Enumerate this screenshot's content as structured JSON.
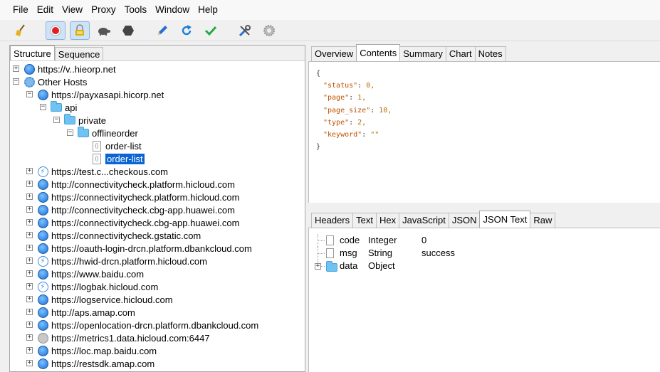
{
  "menu": [
    "File",
    "Edit",
    "View",
    "Proxy",
    "Tools",
    "Window",
    "Help"
  ],
  "toolbar": [
    {
      "name": "broom-icon",
      "color": "#e8b21a"
    },
    {
      "name": "record-icon",
      "color": "#e02020",
      "pressed": true
    },
    {
      "name": "ssl-lock-icon",
      "color": "#e0b000",
      "pressed": true
    },
    {
      "name": "throttle-turtle-icon",
      "color": "#555555"
    },
    {
      "name": "breakpoint-hexagon-icon",
      "color": "#444444"
    },
    {
      "name": "compose-pen-icon",
      "color": "#2a6fd0"
    },
    {
      "name": "repeat-icon",
      "color": "#1a7fd6"
    },
    {
      "name": "validate-check-icon",
      "color": "#22aa44"
    },
    {
      "name": "tools-icon",
      "color": "#2a6fd0"
    },
    {
      "name": "settings-gear-icon",
      "color": "#9a9a9a"
    }
  ],
  "left_tabs": [
    "Structure",
    "Sequence"
  ],
  "tree": [
    {
      "label": "https://v..hieorp.net",
      "depth": 0,
      "expander": "+",
      "icon": "globe-icon"
    },
    {
      "label": "Other Hosts",
      "depth": 0,
      "expander": "−",
      "icon": "gear-icon"
    },
    {
      "label": "https://payxasapi.hicorp.net",
      "depth": 1,
      "expander": "−",
      "icon": "globe-icon"
    },
    {
      "label": "api",
      "depth": 2,
      "expander": "−",
      "icon": "folder-icon"
    },
    {
      "label": "private",
      "depth": 3,
      "expander": "−",
      "icon": "folder-icon"
    },
    {
      "label": "offlineorder",
      "depth": 4,
      "expander": "−",
      "icon": "folder-icon"
    },
    {
      "label": "order-list",
      "depth": 5,
      "expander": "",
      "icon": "request-icon"
    },
    {
      "label": "order-list",
      "depth": 5,
      "expander": "",
      "icon": "request-icon",
      "selected": true
    },
    {
      "label": "https://test.c...checkous.com",
      "depth": 1,
      "expander": "+",
      "icon": "hwid-icon"
    },
    {
      "label": "http://connectivitycheck.platform.hicloud.com",
      "depth": 1,
      "expander": "+",
      "icon": "globe-icon"
    },
    {
      "label": "https://connectivitycheck.platform.hicloud.com",
      "depth": 1,
      "expander": "+",
      "icon": "globe-icon"
    },
    {
      "label": "http://connectivitycheck.cbg-app.huawei.com",
      "depth": 1,
      "expander": "+",
      "icon": "globe-icon"
    },
    {
      "label": "https://connectivitycheck.cbg-app.huawei.com",
      "depth": 1,
      "expander": "+",
      "icon": "globe-icon"
    },
    {
      "label": "https://connectivitycheck.gstatic.com",
      "depth": 1,
      "expander": "+",
      "icon": "globe-icon"
    },
    {
      "label": "https://oauth-login-drcn.platform.dbankcloud.com",
      "depth": 1,
      "expander": "+",
      "icon": "globe-icon"
    },
    {
      "label": "https://hwid-drcn.platform.hicloud.com",
      "depth": 1,
      "expander": "+",
      "icon": "hwid-icon"
    },
    {
      "label": "https://www.baidu.com",
      "depth": 1,
      "expander": "+",
      "icon": "globe-icon"
    },
    {
      "label": "https://logbak.hicloud.com",
      "depth": 1,
      "expander": "+",
      "icon": "hwid-icon"
    },
    {
      "label": "https://logservice.hicloud.com",
      "depth": 1,
      "expander": "+",
      "icon": "globe-icon"
    },
    {
      "label": "http://aps.amap.com",
      "depth": 1,
      "expander": "+",
      "icon": "globe-icon"
    },
    {
      "label": "https://openlocation-drcn.platform.dbankcloud.com",
      "depth": 1,
      "expander": "+",
      "icon": "globe-icon"
    },
    {
      "label": "https://metrics1.data.hicloud.com:6447",
      "depth": 1,
      "expander": "+",
      "icon": "lock-globe-icon"
    },
    {
      "label": "https://loc.map.baidu.com",
      "depth": 1,
      "expander": "+",
      "icon": "globe-icon"
    },
    {
      "label": "https://restsdk.amap.com",
      "depth": 1,
      "expander": "+",
      "icon": "globe-icon"
    }
  ],
  "request_tabs": [
    {
      "label": "Overview"
    },
    {
      "label": "Contents",
      "active": true
    },
    {
      "label": "Summary"
    },
    {
      "label": "Chart"
    },
    {
      "label": "Notes"
    }
  ],
  "request_json": {
    "open": "{",
    "fields": [
      {
        "key": "\"status\"",
        "value": "0,"
      },
      {
        "key": "\"page\"",
        "value": "1,"
      },
      {
        "key": "\"page_size\"",
        "value": "10,"
      },
      {
        "key": "\"type\"",
        "value": "2,"
      },
      {
        "key": "\"keyword\"",
        "value": "\"\""
      }
    ],
    "close": "}"
  },
  "response_tabs": [
    {
      "label": "Headers"
    },
    {
      "label": "Text"
    },
    {
      "label": "Hex"
    },
    {
      "label": "JavaScript"
    },
    {
      "label": "JSON"
    },
    {
      "label": "JSON Text",
      "active": true
    },
    {
      "label": "Raw"
    }
  ],
  "response_tree": [
    {
      "name": "code",
      "type": "Integer",
      "value": "0",
      "icon": "file-icon"
    },
    {
      "name": "msg",
      "type": "String",
      "value": "success",
      "icon": "file-icon"
    },
    {
      "name": "data",
      "type": "Object",
      "value": "",
      "icon": "folder-icon",
      "expander": "+"
    }
  ]
}
